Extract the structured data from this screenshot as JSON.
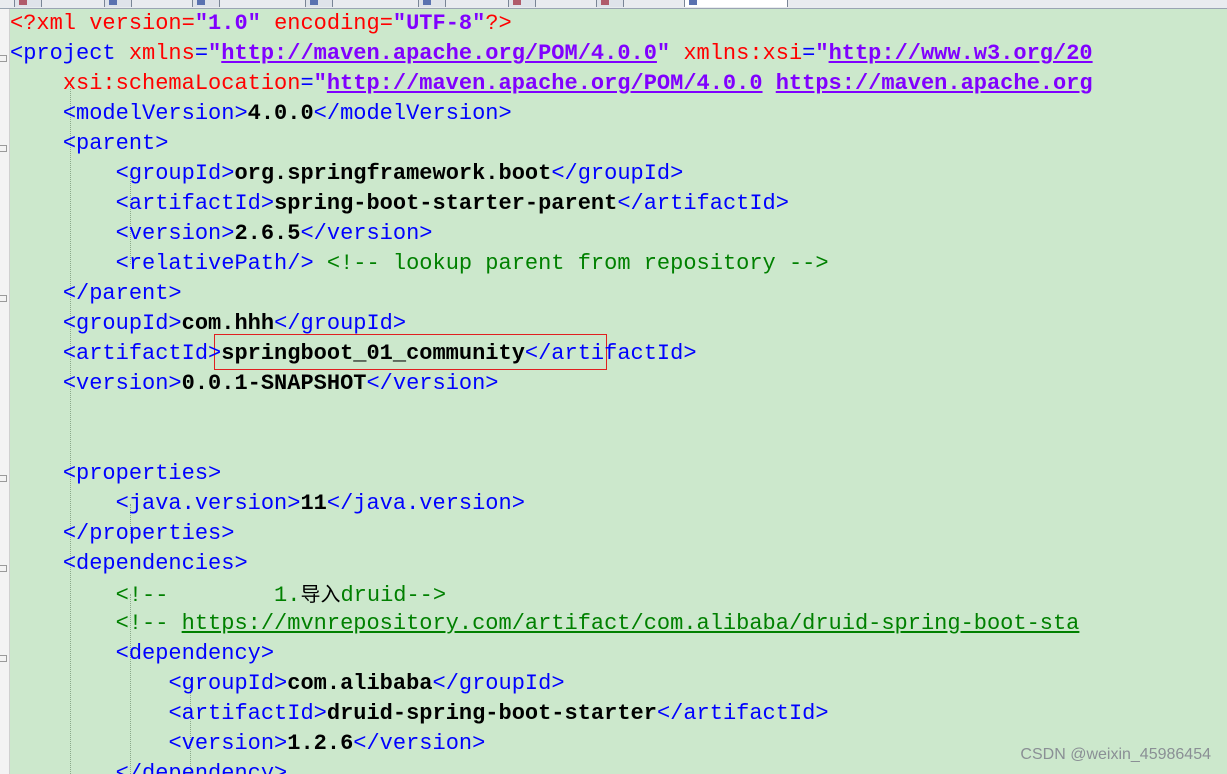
{
  "editor": {
    "lines": [
      [
        {
          "t": "pi",
          "v": "<?xml "
        },
        {
          "t": "attr",
          "v": "version"
        },
        {
          "t": "pi",
          "v": "="
        },
        {
          "t": "val",
          "v": "\"1.0\""
        },
        {
          "t": "pi",
          "v": " "
        },
        {
          "t": "attr",
          "v": "encoding"
        },
        {
          "t": "pi",
          "v": "="
        },
        {
          "t": "val",
          "v": "\"UTF-8\""
        },
        {
          "t": "pi",
          "v": "?>"
        }
      ],
      [
        {
          "t": "tag",
          "v": "<project "
        },
        {
          "t": "attr",
          "v": "xmlns"
        },
        {
          "t": "tag",
          "v": "="
        },
        {
          "t": "val",
          "v": "\""
        },
        {
          "t": "link",
          "v": "http://maven.apache.org/POM/4.0.0"
        },
        {
          "t": "val",
          "v": "\""
        },
        {
          "t": "tag",
          "v": " "
        },
        {
          "t": "attr",
          "v": "xmlns:xsi"
        },
        {
          "t": "tag",
          "v": "="
        },
        {
          "t": "val",
          "v": "\""
        },
        {
          "t": "link",
          "v": "http://www.w3.org/20"
        }
      ],
      [
        {
          "t": "plain",
          "v": "    "
        },
        {
          "t": "attr",
          "v": "xsi:schemaLocation"
        },
        {
          "t": "tag",
          "v": "="
        },
        {
          "t": "val",
          "v": "\""
        },
        {
          "t": "link",
          "v": "http://maven.apache.org/POM/4.0.0"
        },
        {
          "t": "val",
          "v": " "
        },
        {
          "t": "link",
          "v": "https://maven.apache.org"
        }
      ],
      [
        {
          "t": "plain",
          "v": "    "
        },
        {
          "t": "tag",
          "v": "<modelVersion>"
        },
        {
          "t": "text",
          "v": "4.0.0"
        },
        {
          "t": "tag",
          "v": "</modelVersion>"
        }
      ],
      [
        {
          "t": "plain",
          "v": "    "
        },
        {
          "t": "tag",
          "v": "<parent>"
        }
      ],
      [
        {
          "t": "plain",
          "v": "        "
        },
        {
          "t": "tag",
          "v": "<groupId>"
        },
        {
          "t": "text",
          "v": "org.springframework.boot"
        },
        {
          "t": "tag",
          "v": "</groupId>"
        }
      ],
      [
        {
          "t": "plain",
          "v": "        "
        },
        {
          "t": "tag",
          "v": "<artifactId>"
        },
        {
          "t": "text",
          "v": "spring-boot-starter-parent"
        },
        {
          "t": "tag",
          "v": "</artifactId>"
        }
      ],
      [
        {
          "t": "plain",
          "v": "        "
        },
        {
          "t": "tag",
          "v": "<version>"
        },
        {
          "t": "text",
          "v": "2.6.5"
        },
        {
          "t": "tag",
          "v": "</version>"
        }
      ],
      [
        {
          "t": "plain",
          "v": "        "
        },
        {
          "t": "tag",
          "v": "<relativePath/>"
        },
        {
          "t": "plain",
          "v": " "
        },
        {
          "t": "comment",
          "v": "<!-- lookup parent from repository -->"
        }
      ],
      [
        {
          "t": "plain",
          "v": "    "
        },
        {
          "t": "tag",
          "v": "</parent>"
        }
      ],
      [
        {
          "t": "plain",
          "v": "    "
        },
        {
          "t": "tag",
          "v": "<groupId>"
        },
        {
          "t": "text",
          "v": "com.hhh"
        },
        {
          "t": "tag",
          "v": "</groupId>"
        }
      ],
      [
        {
          "t": "plain",
          "v": "    "
        },
        {
          "t": "tag",
          "v": "<artifactId>"
        },
        {
          "t": "text",
          "v": "springboot_01_community"
        },
        {
          "t": "tag",
          "v": "</artifactId>"
        }
      ],
      [
        {
          "t": "plain",
          "v": "    "
        },
        {
          "t": "tag",
          "v": "<version>"
        },
        {
          "t": "text",
          "v": "0.0.1-SNAPSHOT"
        },
        {
          "t": "tag",
          "v": "</version>"
        }
      ],
      [],
      [],
      [
        {
          "t": "plain",
          "v": "    "
        },
        {
          "t": "tag",
          "v": "<properties>"
        }
      ],
      [
        {
          "t": "plain",
          "v": "        "
        },
        {
          "t": "tag",
          "v": "<java.version>"
        },
        {
          "t": "text",
          "v": "11"
        },
        {
          "t": "tag",
          "v": "</java.version>"
        }
      ],
      [
        {
          "t": "plain",
          "v": "    "
        },
        {
          "t": "tag",
          "v": "</properties>"
        }
      ],
      [
        {
          "t": "plain",
          "v": "    "
        },
        {
          "t": "tag",
          "v": "<dependencies>"
        }
      ],
      [
        {
          "t": "plain",
          "v": "        "
        },
        {
          "t": "comment",
          "v": "<!--        1."
        },
        {
          "t": "cjk",
          "v": "导入"
        },
        {
          "t": "comment",
          "v": "druid-->"
        }
      ],
      [
        {
          "t": "plain",
          "v": "        "
        },
        {
          "t": "comment",
          "v": "<!-- "
        },
        {
          "t": "clink",
          "v": "https://mvnrepository.com/artifact/com.alibaba/druid-spring-boot-sta"
        }
      ],
      [
        {
          "t": "plain",
          "v": "        "
        },
        {
          "t": "tag",
          "v": "<dependency>"
        }
      ],
      [
        {
          "t": "plain",
          "v": "            "
        },
        {
          "t": "tag",
          "v": "<groupId>"
        },
        {
          "t": "text",
          "v": "com.alibaba"
        },
        {
          "t": "tag",
          "v": "</groupId>"
        }
      ],
      [
        {
          "t": "plain",
          "v": "            "
        },
        {
          "t": "tag",
          "v": "<artifactId>"
        },
        {
          "t": "text",
          "v": "druid-spring-boot-starter"
        },
        {
          "t": "tag",
          "v": "</artifactId>"
        }
      ],
      [
        {
          "t": "plain",
          "v": "            "
        },
        {
          "t": "tag",
          "v": "<version>"
        },
        {
          "t": "text",
          "v": "1.2.6"
        },
        {
          "t": "tag",
          "v": "</version>"
        }
      ],
      [
        {
          "t": "plain",
          "v": "        "
        },
        {
          "t": "tag",
          "v": "</dependency>"
        }
      ]
    ]
  },
  "colors": {
    "editor_background": "#cce8cc",
    "tag": "#0000ff",
    "attribute": "#ff0000",
    "value": "#8000ff",
    "comment": "#008000",
    "highlight_box": "#e02020"
  },
  "watermark": "CSDN @weixin_45986454"
}
